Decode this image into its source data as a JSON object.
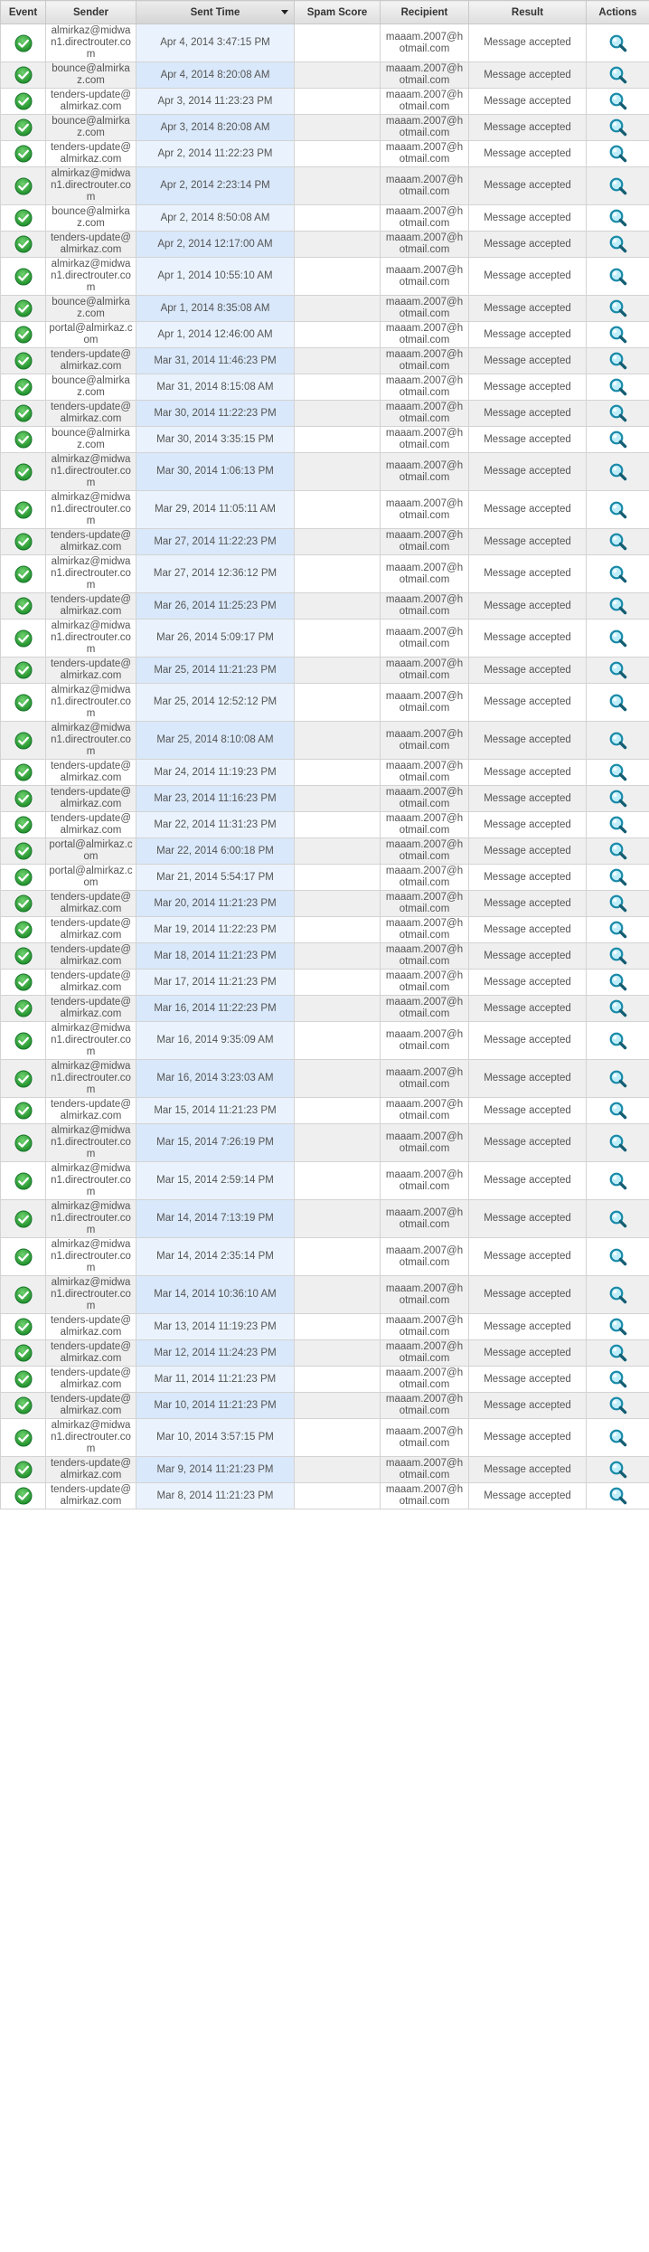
{
  "columns": {
    "event": "Event",
    "sender": "Sender",
    "sent_time": "Sent Time",
    "spam_score": "Spam Score",
    "recipient": "Recipient",
    "result": "Result",
    "actions": "Actions"
  },
  "colors": {
    "success_icon": "#2ea043",
    "header_bg": "#e6e6e6",
    "time_column_bg": "#eaf3fd",
    "search_icon": "#1a8aa8"
  },
  "icons": {
    "event": "check-circle-icon",
    "action": "magnifier-icon"
  },
  "rows": [
    {
      "sender": "almirkaz@midwan1.directrouter.com",
      "sent_time": "Apr 4, 2014 3:47:15 PM",
      "spam_score": "",
      "recipient": "maaam.2007@hotmail.com",
      "result": "Message accepted"
    },
    {
      "sender": "bounce@almirkaz.com",
      "sent_time": "Apr 4, 2014 8:20:08 AM",
      "spam_score": "",
      "recipient": "maaam.2007@hotmail.com",
      "result": "Message accepted"
    },
    {
      "sender": "tenders-update@almirkaz.com",
      "sent_time": "Apr 3, 2014 11:23:23 PM",
      "spam_score": "",
      "recipient": "maaam.2007@hotmail.com",
      "result": "Message accepted"
    },
    {
      "sender": "bounce@almirkaz.com",
      "sent_time": "Apr 3, 2014 8:20:08 AM",
      "spam_score": "",
      "recipient": "maaam.2007@hotmail.com",
      "result": "Message accepted"
    },
    {
      "sender": "tenders-update@almirkaz.com",
      "sent_time": "Apr 2, 2014 11:22:23 PM",
      "spam_score": "",
      "recipient": "maaam.2007@hotmail.com",
      "result": "Message accepted"
    },
    {
      "sender": "almirkaz@midwan1.directrouter.com",
      "sent_time": "Apr 2, 2014 2:23:14 PM",
      "spam_score": "",
      "recipient": "maaam.2007@hotmail.com",
      "result": "Message accepted"
    },
    {
      "sender": "bounce@almirkaz.com",
      "sent_time": "Apr 2, 2014 8:50:08 AM",
      "spam_score": "",
      "recipient": "maaam.2007@hotmail.com",
      "result": "Message accepted"
    },
    {
      "sender": "tenders-update@almirkaz.com",
      "sent_time": "Apr 2, 2014 12:17:00 AM",
      "spam_score": "",
      "recipient": "maaam.2007@hotmail.com",
      "result": "Message accepted"
    },
    {
      "sender": "almirkaz@midwan1.directrouter.com",
      "sent_time": "Apr 1, 2014 10:55:10 AM",
      "spam_score": "",
      "recipient": "maaam.2007@hotmail.com",
      "result": "Message accepted"
    },
    {
      "sender": "bounce@almirkaz.com",
      "sent_time": "Apr 1, 2014 8:35:08 AM",
      "spam_score": "",
      "recipient": "maaam.2007@hotmail.com",
      "result": "Message accepted"
    },
    {
      "sender": "portal@almirkaz.com",
      "sent_time": "Apr 1, 2014 12:46:00 AM",
      "spam_score": "",
      "recipient": "maaam.2007@hotmail.com",
      "result": "Message accepted"
    },
    {
      "sender": "tenders-update@almirkaz.com",
      "sent_time": "Mar 31, 2014 11:46:23 PM",
      "spam_score": "",
      "recipient": "maaam.2007@hotmail.com",
      "result": "Message accepted"
    },
    {
      "sender": "bounce@almirkaz.com",
      "sent_time": "Mar 31, 2014 8:15:08 AM",
      "spam_score": "",
      "recipient": "maaam.2007@hotmail.com",
      "result": "Message accepted"
    },
    {
      "sender": "tenders-update@almirkaz.com",
      "sent_time": "Mar 30, 2014 11:22:23 PM",
      "spam_score": "",
      "recipient": "maaam.2007@hotmail.com",
      "result": "Message accepted"
    },
    {
      "sender": "bounce@almirkaz.com",
      "sent_time": "Mar 30, 2014 3:35:15 PM",
      "spam_score": "",
      "recipient": "maaam.2007@hotmail.com",
      "result": "Message accepted"
    },
    {
      "sender": "almirkaz@midwan1.directrouter.com",
      "sent_time": "Mar 30, 2014 1:06:13 PM",
      "spam_score": "",
      "recipient": "maaam.2007@hotmail.com",
      "result": "Message accepted"
    },
    {
      "sender": "almirkaz@midwan1.directrouter.com",
      "sent_time": "Mar 29, 2014 11:05:11 AM",
      "spam_score": "",
      "recipient": "maaam.2007@hotmail.com",
      "result": "Message accepted"
    },
    {
      "sender": "tenders-update@almirkaz.com",
      "sent_time": "Mar 27, 2014 11:22:23 PM",
      "spam_score": "",
      "recipient": "maaam.2007@hotmail.com",
      "result": "Message accepted"
    },
    {
      "sender": "almirkaz@midwan1.directrouter.com",
      "sent_time": "Mar 27, 2014 12:36:12 PM",
      "spam_score": "",
      "recipient": "maaam.2007@hotmail.com",
      "result": "Message accepted"
    },
    {
      "sender": "tenders-update@almirkaz.com",
      "sent_time": "Mar 26, 2014 11:25:23 PM",
      "spam_score": "",
      "recipient": "maaam.2007@hotmail.com",
      "result": "Message accepted"
    },
    {
      "sender": "almirkaz@midwan1.directrouter.com",
      "sent_time": "Mar 26, 2014 5:09:17 PM",
      "spam_score": "",
      "recipient": "maaam.2007@hotmail.com",
      "result": "Message accepted"
    },
    {
      "sender": "tenders-update@almirkaz.com",
      "sent_time": "Mar 25, 2014 11:21:23 PM",
      "spam_score": "",
      "recipient": "maaam.2007@hotmail.com",
      "result": "Message accepted"
    },
    {
      "sender": "almirkaz@midwan1.directrouter.com",
      "sent_time": "Mar 25, 2014 12:52:12 PM",
      "spam_score": "",
      "recipient": "maaam.2007@hotmail.com",
      "result": "Message accepted"
    },
    {
      "sender": "almirkaz@midwan1.directrouter.com",
      "sent_time": "Mar 25, 2014 8:10:08 AM",
      "spam_score": "",
      "recipient": "maaam.2007@hotmail.com",
      "result": "Message accepted"
    },
    {
      "sender": "tenders-update@almirkaz.com",
      "sent_time": "Mar 24, 2014 11:19:23 PM",
      "spam_score": "",
      "recipient": "maaam.2007@hotmail.com",
      "result": "Message accepted"
    },
    {
      "sender": "tenders-update@almirkaz.com",
      "sent_time": "Mar 23, 2014 11:16:23 PM",
      "spam_score": "",
      "recipient": "maaam.2007@hotmail.com",
      "result": "Message accepted"
    },
    {
      "sender": "tenders-update@almirkaz.com",
      "sent_time": "Mar 22, 2014 11:31:23 PM",
      "spam_score": "",
      "recipient": "maaam.2007@hotmail.com",
      "result": "Message accepted"
    },
    {
      "sender": "portal@almirkaz.com",
      "sent_time": "Mar 22, 2014 6:00:18 PM",
      "spam_score": "",
      "recipient": "maaam.2007@hotmail.com",
      "result": "Message accepted"
    },
    {
      "sender": "portal@almirkaz.com",
      "sent_time": "Mar 21, 2014 5:54:17 PM",
      "spam_score": "",
      "recipient": "maaam.2007@hotmail.com",
      "result": "Message accepted"
    },
    {
      "sender": "tenders-update@almirkaz.com",
      "sent_time": "Mar 20, 2014 11:21:23 PM",
      "spam_score": "",
      "recipient": "maaam.2007@hotmail.com",
      "result": "Message accepted"
    },
    {
      "sender": "tenders-update@almirkaz.com",
      "sent_time": "Mar 19, 2014 11:22:23 PM",
      "spam_score": "",
      "recipient": "maaam.2007@hotmail.com",
      "result": "Message accepted"
    },
    {
      "sender": "tenders-update@almirkaz.com",
      "sent_time": "Mar 18, 2014 11:21:23 PM",
      "spam_score": "",
      "recipient": "maaam.2007@hotmail.com",
      "result": "Message accepted"
    },
    {
      "sender": "tenders-update@almirkaz.com",
      "sent_time": "Mar 17, 2014 11:21:23 PM",
      "spam_score": "",
      "recipient": "maaam.2007@hotmail.com",
      "result": "Message accepted"
    },
    {
      "sender": "tenders-update@almirkaz.com",
      "sent_time": "Mar 16, 2014 11:22:23 PM",
      "spam_score": "",
      "recipient": "maaam.2007@hotmail.com",
      "result": "Message accepted"
    },
    {
      "sender": "almirkaz@midwan1.directrouter.com",
      "sent_time": "Mar 16, 2014 9:35:09 AM",
      "spam_score": "",
      "recipient": "maaam.2007@hotmail.com",
      "result": "Message accepted"
    },
    {
      "sender": "almirkaz@midwan1.directrouter.com",
      "sent_time": "Mar 16, 2014 3:23:03 AM",
      "spam_score": "",
      "recipient": "maaam.2007@hotmail.com",
      "result": "Message accepted"
    },
    {
      "sender": "tenders-update@almirkaz.com",
      "sent_time": "Mar 15, 2014 11:21:23 PM",
      "spam_score": "",
      "recipient": "maaam.2007@hotmail.com",
      "result": "Message accepted"
    },
    {
      "sender": "almirkaz@midwan1.directrouter.com",
      "sent_time": "Mar 15, 2014 7:26:19 PM",
      "spam_score": "",
      "recipient": "maaam.2007@hotmail.com",
      "result": "Message accepted"
    },
    {
      "sender": "almirkaz@midwan1.directrouter.com",
      "sent_time": "Mar 15, 2014 2:59:14 PM",
      "spam_score": "",
      "recipient": "maaam.2007@hotmail.com",
      "result": "Message accepted"
    },
    {
      "sender": "almirkaz@midwan1.directrouter.com",
      "sent_time": "Mar 14, 2014 7:13:19 PM",
      "spam_score": "",
      "recipient": "maaam.2007@hotmail.com",
      "result": "Message accepted"
    },
    {
      "sender": "almirkaz@midwan1.directrouter.com",
      "sent_time": "Mar 14, 2014 2:35:14 PM",
      "spam_score": "",
      "recipient": "maaam.2007@hotmail.com",
      "result": "Message accepted"
    },
    {
      "sender": "almirkaz@midwan1.directrouter.com",
      "sent_time": "Mar 14, 2014 10:36:10 AM",
      "spam_score": "",
      "recipient": "maaam.2007@hotmail.com",
      "result": "Message accepted"
    },
    {
      "sender": "tenders-update@almirkaz.com",
      "sent_time": "Mar 13, 2014 11:19:23 PM",
      "spam_score": "",
      "recipient": "maaam.2007@hotmail.com",
      "result": "Message accepted"
    },
    {
      "sender": "tenders-update@almirkaz.com",
      "sent_time": "Mar 12, 2014 11:24:23 PM",
      "spam_score": "",
      "recipient": "maaam.2007@hotmail.com",
      "result": "Message accepted"
    },
    {
      "sender": "tenders-update@almirkaz.com",
      "sent_time": "Mar 11, 2014 11:21:23 PM",
      "spam_score": "",
      "recipient": "maaam.2007@hotmail.com",
      "result": "Message accepted"
    },
    {
      "sender": "tenders-update@almirkaz.com",
      "sent_time": "Mar 10, 2014 11:21:23 PM",
      "spam_score": "",
      "recipient": "maaam.2007@hotmail.com",
      "result": "Message accepted"
    },
    {
      "sender": "almirkaz@midwan1.directrouter.com",
      "sent_time": "Mar 10, 2014 3:57:15 PM",
      "spam_score": "",
      "recipient": "maaam.2007@hotmail.com",
      "result": "Message accepted"
    },
    {
      "sender": "tenders-update@almirkaz.com",
      "sent_time": "Mar 9, 2014 11:21:23 PM",
      "spam_score": "",
      "recipient": "maaam.2007@hotmail.com",
      "result": "Message accepted"
    },
    {
      "sender": "tenders-update@almirkaz.com",
      "sent_time": "Mar 8, 2014 11:21:23 PM",
      "spam_score": "",
      "recipient": "maaam.2007@hotmail.com",
      "result": "Message accepted"
    }
  ]
}
